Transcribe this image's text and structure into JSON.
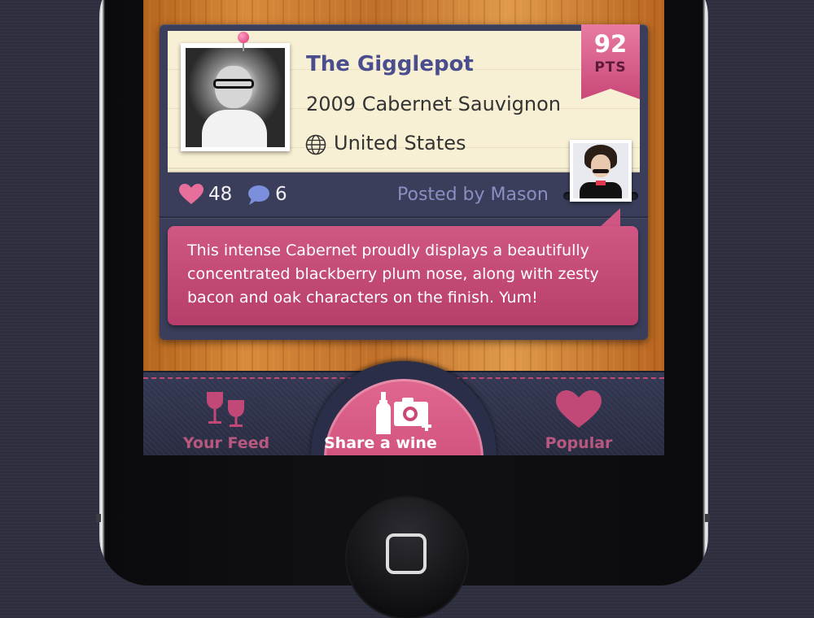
{
  "post": {
    "wine_name": "The Gigglepot",
    "vintage": "2009 Cabernet Sauvignon",
    "country": "United States",
    "score": "92",
    "score_unit": "PTS",
    "likes": "48",
    "comments": "6",
    "posted_by": "Posted by Mason",
    "review": "This intense Cabernet proudly displays a beautifully concentrated blackberry plum nose, along with zesty bacon and oak characters on the finish. Yum!"
  },
  "tabbar": {
    "feed_label": "Your Feed",
    "share_label": "Share a wine",
    "popular_label": "Popular"
  },
  "icons": {
    "likes": "heart-icon",
    "comments": "speech-bubble-icon",
    "country": "globe-icon",
    "feed": "wine-glasses-icon",
    "share": "bottle-camera-icon",
    "popular": "heart-icon"
  },
  "colors": {
    "accent_pink": "#c94878",
    "card_navy": "#3a3e5a",
    "title_purple": "#4a4d8e",
    "paper": "#f8f0d4"
  }
}
